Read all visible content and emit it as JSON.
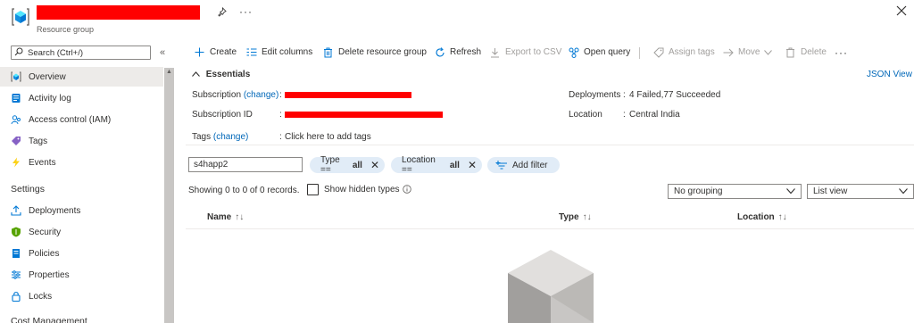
{
  "header": {
    "subtitle": "Resource group",
    "more_label": "···"
  },
  "sidebar": {
    "search_placeholder": "Search (Ctrl+/)",
    "collapse_label": "«",
    "items": [
      {
        "label": "Overview",
        "icon": "resource-group-icon"
      },
      {
        "label": "Activity log",
        "icon": "activity-log-icon"
      },
      {
        "label": "Access control (IAM)",
        "icon": "iam-icon"
      },
      {
        "label": "Tags",
        "icon": "tag-icon"
      },
      {
        "label": "Events",
        "icon": "bolt-icon"
      }
    ],
    "section_settings": "Settings",
    "settings_items": [
      {
        "label": "Deployments",
        "icon": "deploy-icon"
      },
      {
        "label": "Security",
        "icon": "shield-icon"
      },
      {
        "label": "Policies",
        "icon": "policy-icon"
      },
      {
        "label": "Properties",
        "icon": "properties-icon"
      },
      {
        "label": "Locks",
        "icon": "lock-icon"
      }
    ],
    "section_cost": "Cost Management"
  },
  "toolbar": {
    "create": "Create",
    "edit_columns": "Edit columns",
    "delete_group": "Delete resource group",
    "refresh": "Refresh",
    "export_csv": "Export to CSV",
    "open_query": "Open query",
    "assign_tags": "Assign tags",
    "move": "Move",
    "delete": "Delete",
    "more": "···"
  },
  "essentials": {
    "heading": "Essentials",
    "json_view": "JSON View",
    "subscription_label": "Subscription",
    "change_label": "(change)",
    "subscription_id_label": "Subscription ID",
    "tags_label": "Tags",
    "tags_value": "Click here to add tags",
    "deployments_label": "Deployments",
    "deployments_value": "4 Failed,77 Succeeded",
    "location_label": "Location",
    "location_value": "Central India"
  },
  "filters": {
    "search_value": "s4happ2",
    "type_label": "Type ==",
    "type_value": "all",
    "location_label": "Location ==",
    "location_value": "all",
    "add_filter": "Add filter",
    "records": "Showing 0 to 0 of 0 records.",
    "show_hidden": "Show hidden types",
    "grouping": "No grouping",
    "view": "List view"
  },
  "table": {
    "columns": [
      "Name",
      "Type",
      "Location"
    ],
    "rows": []
  },
  "colors": {
    "accent": "#0067b8",
    "redaction": "#ff0000",
    "pill_bg": "#e1ecf7",
    "selected_nav": "#edebe9"
  }
}
